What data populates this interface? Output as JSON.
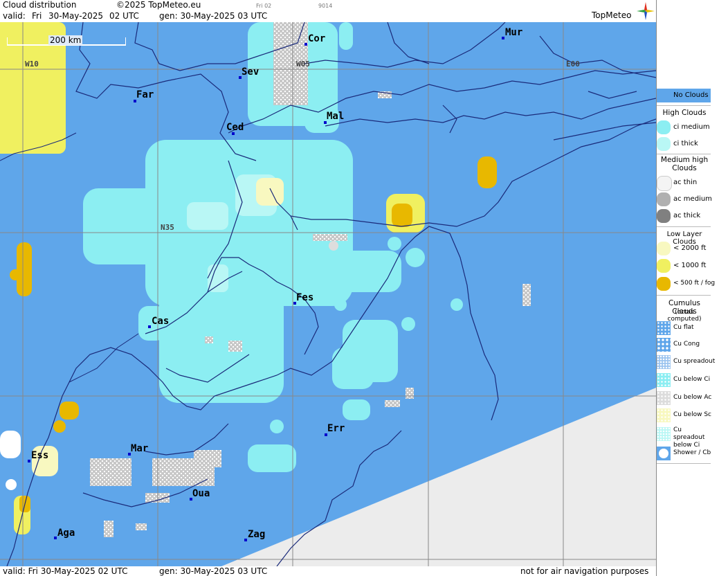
{
  "header": {
    "title": "Cloud distribution",
    "copyright": "©2025 TopMeteo.eu",
    "valid_label": "valid:",
    "valid_day": "Fri",
    "valid_date": "30-May-2025",
    "valid_time": "02 UTC",
    "gen_label": "gen: 30-May-2025 03 UTC",
    "small_day": "Fri 02",
    "small_code": "9014",
    "logo": "TopMeteo"
  },
  "footer": {
    "valid": "valid:  Fri  30-May-2025  02 UTC",
    "gen": "gen: 30-May-2025 03 UTC",
    "disclaimer": "not for air navigation purposes"
  },
  "map": {
    "scale_label": "200 km",
    "grid_labels": [
      "W10",
      "W05",
      "E00",
      "N35"
    ],
    "cities": [
      "Cor",
      "Mur",
      "Sev",
      "Far",
      "Mal",
      "Ced",
      "Fes",
      "Cas",
      "Err",
      "Mar",
      "Ess",
      "Oua",
      "Aga",
      "Zag"
    ],
    "colors": {
      "no_clouds": "#5fa6ea",
      "ci_medium": "#8ceef2",
      "ci_thick": "#b9f7f5",
      "low_2000": "#f8f8c0",
      "low_1000": "#f0f060",
      "low_500": "#e8b800",
      "outside": "#ececec"
    }
  },
  "legend": {
    "no_clouds": "No Clouds",
    "high_head": "High Clouds",
    "ci_medium": "ci medium",
    "ci_thick": "ci thick",
    "medium_head": "Medium high Clouds",
    "ac_thin": "ac thin",
    "ac_medium": "ac medium",
    "ac_thick": "ac thick",
    "low_head": "Low Layer Clouds",
    "low_2000": "< 2000 ft",
    "low_1000": "< 1000 ft",
    "low_500": "< 500 ft / fog",
    "cu_head": "Cumulus Clouds",
    "cu_sub": "(octas computed)",
    "cu_flat": "Cu flat",
    "cu_cong": "Cu Cong",
    "cu_spread": "Cu spreadout",
    "cu_below_ci": "Cu below Ci",
    "cu_below_ac": "Cu below Ac",
    "cu_below_sc": "Cu below Sc",
    "cu_spread_ci": "Cu spreadout below Ci",
    "shower": "Shower / Cb"
  }
}
